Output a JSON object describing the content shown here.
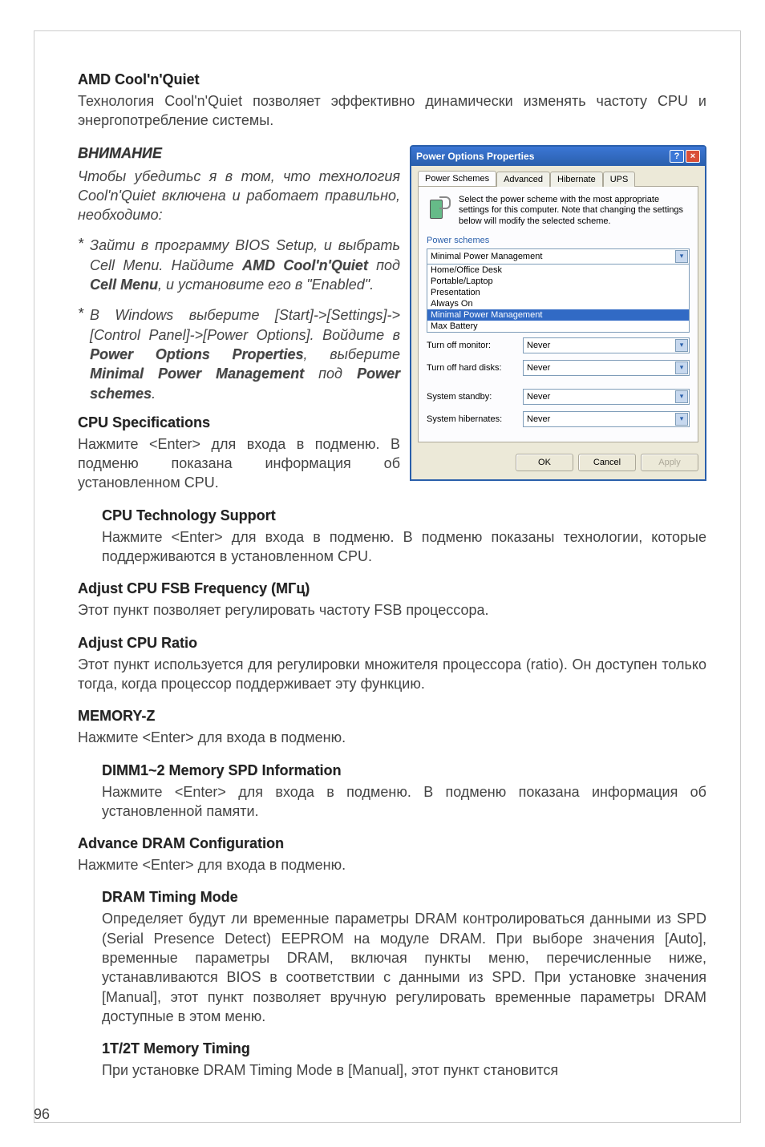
{
  "sections": {
    "amd_cnc": {
      "title": "AMD Cool'n'Quiet",
      "body": "Технология Cool'n'Quiet позволяет эффективно динамически изменять частоту CPU и энергопотребление системы."
    },
    "attention": {
      "title": "ВНИМАНИЕ",
      "intro_a": "Чтобы убедитьс я в том, что технология Cool'n'Quiet включена и работает правильно, необходимо:",
      "bullet1_a": "Зайти в программу BIOS Setup, и выбрать Cell Menu. Найдите ",
      "bullet1_b": " под ",
      "bullet1_c": ", и установите его в \"Enabled\".",
      "bold1a": "AMD Cool'n'Quiet",
      "bold1b": "Cell Menu",
      "bullet2_a": "В Windows выберите [Start]->[Settings]->[Control Panel]->[Power Options]. Войдите в ",
      "bullet2_b": ", выберите ",
      "bullet2_c": " под ",
      "bold2a": "Power Options Properties",
      "bold2b": "Minimal Power Management",
      "bold2c": "Power schemes",
      "dot": "."
    },
    "cpu_spec": {
      "title": "CPU Specifications",
      "body": "Нажмите <Enter> для входа в подменю. В подменю показана информация об установленном CPU."
    },
    "cpu_tech": {
      "title": "CPU Technology Support",
      "body": "Нажмите <Enter> для входа в подменю. В подменю показаны технологии, которые поддерживаются в установленном CPU."
    },
    "fsb": {
      "title": "Adjust CPU FSB Frequency (МГц)",
      "body": "Этот пункт позволяет регулировать частоту FSB процессора."
    },
    "ratio": {
      "title": "Adjust CPU Ratio",
      "body": "Этот пункт используется для регулировки множителя процессора (ratio). Он доступен только тогда, когда процессор поддерживает эту функцию."
    },
    "memz": {
      "title": "MEMORY-Z",
      "body": "Нажмите <Enter> для входа в подменю."
    },
    "dimm": {
      "title": "DIMM1~2 Memory SPD Information",
      "body": "Нажмите <Enter> для входа в подменю. В подменю показана информация об установленной памяти."
    },
    "adram": {
      "title": "Advance DRAM Configuration",
      "body": "Нажмите <Enter> для входа в подменю."
    },
    "dramtm": {
      "title": "DRAM Timing Mode",
      "body": "Определяет будут ли временные параметры DRAM контролироваться данными из SPD (Serial Presence Detect) EEPROM на модуле DRAM. При выборе значения [Auto], временные параметры DRAM, включая пункты меню, перечисленные ниже, устанавливаются BIOS в соответствии с данными из SPD. При установке значения [Manual], этот пункт позволяет вручную регулировать временные параметры DRAM доступные в этом меню."
    },
    "t12": {
      "title": "1T/2T Memory Timing",
      "body": "При установке DRAM Timing Mode в [Manual], этот пункт становится"
    }
  },
  "dialog": {
    "title": "Power Options Properties",
    "help": "?",
    "close": "×",
    "tabs": {
      "t1": "Power Schemes",
      "t2": "Advanced",
      "t3": "Hibernate",
      "t4": "UPS"
    },
    "desc": "Select the power scheme with the most appropriate settings for this computer. Note that changing the settings below will modify the selected scheme.",
    "group": "Power schemes",
    "combo_sel": "Minimal Power Management",
    "dd": {
      "i1": "Home/Office Desk",
      "i2": "Portable/Laptop",
      "i3": "Presentation",
      "i4": "Always On",
      "i5": "Minimal Power Management",
      "i6": "Max Battery"
    },
    "fields": {
      "f1l": "Turn off monitor:",
      "f1v": "Never",
      "f2l": "Turn off hard disks:",
      "f2v": "Never",
      "f3l": "System standby:",
      "f3v": "Never",
      "f4l": "System hibernates:",
      "f4v": "Never"
    },
    "btns": {
      "ok": "OK",
      "cancel": "Cancel",
      "apply": "Apply"
    }
  },
  "pagenum": "96"
}
